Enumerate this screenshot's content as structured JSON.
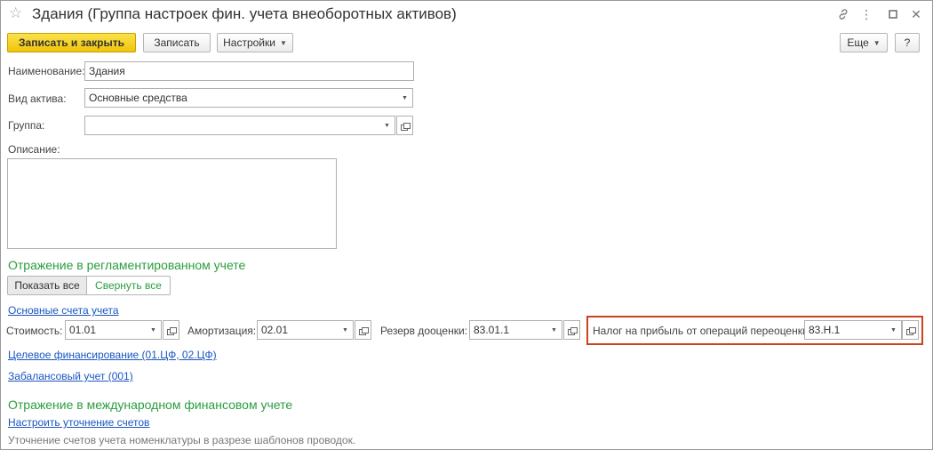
{
  "window": {
    "title": "Здания (Группа настроек фин. учета внеоборотных активов)"
  },
  "toolbar": {
    "save_close_label": "Записать и закрыть",
    "save_label": "Записать",
    "settings_label": "Настройки",
    "more_label": "Еще",
    "help_label": "?"
  },
  "form": {
    "name_label": "Наименование:",
    "name_value": "Здания",
    "asset_type_label": "Вид актива:",
    "asset_type_value": "Основные средства",
    "group_label": "Группа:",
    "group_value": "",
    "description_label": "Описание:",
    "description_value": ""
  },
  "reg_section": {
    "title": "Отражение в регламентированном учете",
    "show_all_label": "Показать все",
    "collapse_all_label": "Свернуть все",
    "main_accounts_link": "Основные счета учета",
    "cost_label": "Стоимость:",
    "cost_value": "01.01",
    "amort_label": "Амортизация:",
    "amort_value": "02.01",
    "reserve_label": "Резерв дооценки:",
    "reserve_value": "83.01.1",
    "tax_label": "Налог на прибыль от операций переоценки:",
    "tax_value": "83.Н.1",
    "target_finance_link": "Целевое финансирование (01.ЦФ, 02.ЦФ)",
    "offbalance_link": "Забалансовый учет (001)"
  },
  "ifrs_section": {
    "title": "Отражение в международном финансовом учете",
    "setup_link": "Настроить уточнение счетов",
    "note": "Уточнение счетов учета номенклатуры в разрезе шаблонов проводок."
  },
  "colors": {
    "accent_green": "#2a9e3e",
    "link_blue": "#1a56c0",
    "highlight": "#c9441d",
    "primary_button": "#f1c40b"
  }
}
